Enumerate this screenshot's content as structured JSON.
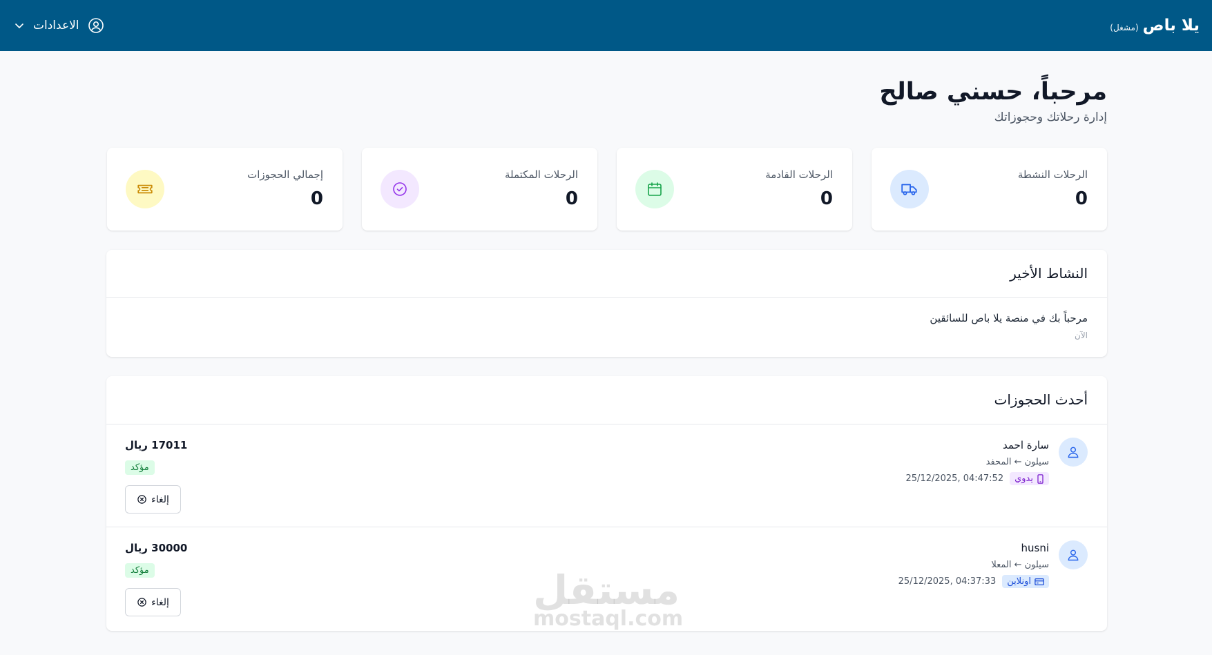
{
  "header": {
    "brand_name": "يلا باص",
    "brand_role": "(مشغل)",
    "settings_label": "الاعدادات"
  },
  "welcome": {
    "title": "مرحباً، حسني صالح",
    "subtitle": "إدارة رحلاتك وحجوزاتك"
  },
  "stats": [
    {
      "label": "الرحلات النشطة",
      "value": "0",
      "icon": "bus-icon",
      "color": "#2563eb",
      "bg": "#dbeafe"
    },
    {
      "label": "الرحلات القادمة",
      "value": "0",
      "icon": "calendar-icon",
      "color": "#16a34a",
      "bg": "#dcfce7"
    },
    {
      "label": "الرحلات المكتملة",
      "value": "0",
      "icon": "check-circle-icon",
      "color": "#9333ea",
      "bg": "#f3e8ff"
    },
    {
      "label": "إجمالي الحجوزات",
      "value": "0",
      "icon": "ticket-icon",
      "color": "#ca8a04",
      "bg": "#fef9c3"
    }
  ],
  "activity": {
    "title": "النشاط الأخير",
    "items": [
      {
        "text": "مرحباً بك في منصة يلا باص للسائقين",
        "time": "الآن"
      }
    ]
  },
  "bookings": {
    "title": "أحدث الحجوزات",
    "items": [
      {
        "name": "سارة احمد",
        "route": "سيلون ← المحفد",
        "date": "25/12/2025, 04:47:52",
        "channel": "يدوي",
        "channel_icon": "mobile-icon",
        "amount": "17011 ريال",
        "status": "مؤكد",
        "cancel_label": "إلغاء"
      },
      {
        "name": "husni",
        "route": "سيلون ← المعلا",
        "date": "25/12/2025, 04:37:33",
        "channel": "اونلاين",
        "channel_icon": "credit-card-icon",
        "amount": "30000 ريال",
        "status": "مؤكد",
        "cancel_label": "إلغاء"
      }
    ]
  },
  "watermark": {
    "arabic": "مستقل",
    "latin": "mostaql.com"
  },
  "colors": {
    "header_bg": "#005887",
    "page_bg": "#f8f9fb"
  }
}
